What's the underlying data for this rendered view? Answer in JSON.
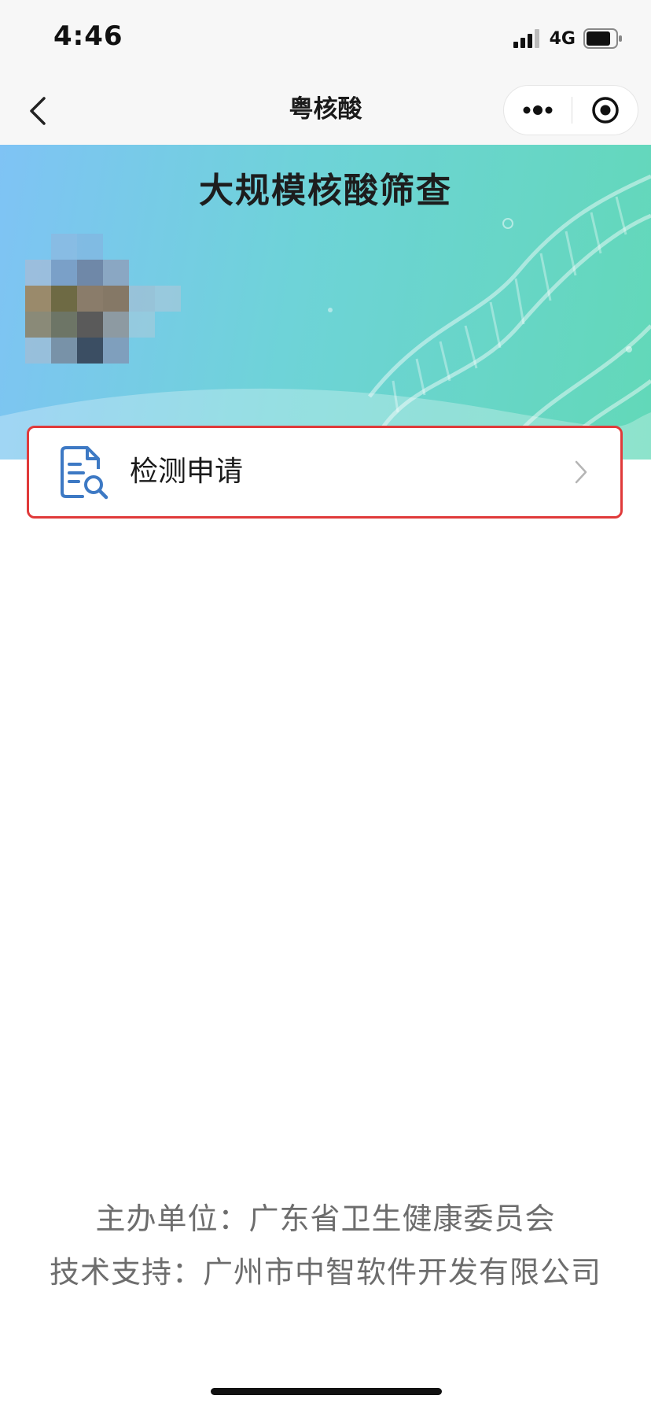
{
  "status_bar": {
    "time": "4:46",
    "network": "4G",
    "icons": [
      "signal-icon",
      "battery-icon"
    ]
  },
  "nav_bar": {
    "title": "粤核酸",
    "icons": [
      "back-icon",
      "more-icon",
      "close-target-icon"
    ]
  },
  "banner": {
    "title": "大规模核酸筛查"
  },
  "menu": {
    "items": [
      {
        "label": "检测申请",
        "icon": "document-search-icon"
      }
    ]
  },
  "footer": {
    "sponsor": "主办单位：广东省卫生健康委员会",
    "tech_support": "技术支持：广州市中智软件开发有限公司"
  },
  "colors": {
    "banner_gradient": [
      "#7fc3f5",
      "#6ed3d8",
      "#62d8b8"
    ],
    "highlight_border": "#e03a3a",
    "icon_blue": "#3d79c4"
  }
}
